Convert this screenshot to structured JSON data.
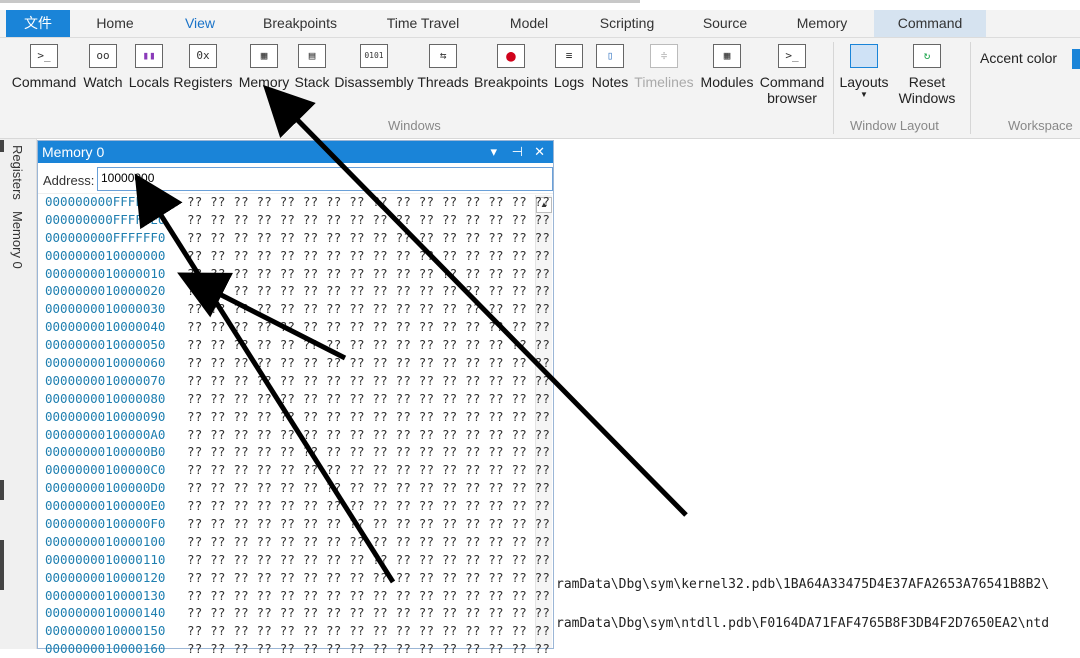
{
  "ribbon_tabs": [
    "文件",
    "Home",
    "View",
    "Breakpoints",
    "Time Travel",
    "Model",
    "Scripting",
    "Source",
    "Memory",
    "Command"
  ],
  "windows_buttons": [
    {
      "label": "Command",
      "icon": "command-prompt-icon",
      "glyph": ">_"
    },
    {
      "label": "Watch",
      "icon": "watch-glasses-icon",
      "glyph": "oo"
    },
    {
      "label": "Locals",
      "icon": "locals-icon",
      "glyph": "▮▮"
    },
    {
      "label": "Registers",
      "icon": "registers-icon",
      "glyph": "0x"
    },
    {
      "label": "Memory",
      "icon": "memory-chip-icon",
      "glyph": "▦"
    },
    {
      "label": "Stack",
      "icon": "stack-icon",
      "glyph": "▤"
    },
    {
      "label": "Disassembly",
      "icon": "disassembly-icon",
      "glyph": "0101"
    },
    {
      "label": "Threads",
      "icon": "threads-icon",
      "glyph": "⇆"
    },
    {
      "label": "Breakpoints",
      "icon": "breakpoint-icon",
      "glyph": "●"
    },
    {
      "label": "Logs",
      "icon": "logs-icon",
      "glyph": "≡"
    },
    {
      "label": "Notes",
      "icon": "notes-icon",
      "glyph": "▯"
    },
    {
      "label": "Timelines",
      "icon": "timelines-icon",
      "glyph": "≑"
    },
    {
      "label": "Modules",
      "icon": "modules-icon",
      "glyph": "▦"
    },
    {
      "label": "Command browser",
      "icon": "command-browser-icon",
      "glyph": ">_"
    }
  ],
  "group_windows": "Windows",
  "layouts_label": "Layouts",
  "reset_label": "Reset Windows",
  "group_window_layout": "Window Layout",
  "accent_label": "Accent color",
  "group_workspace": "Workspace",
  "side_tabs": [
    "Registers",
    "Memory 0"
  ],
  "panel": {
    "title": "Memory 0",
    "address_label": "Address:",
    "address_value": "10000000",
    "rows": [
      "000000000FFFFFD0",
      "000000000FFFFFE0",
      "000000000FFFFFF0",
      "0000000010000000",
      "0000000010000010",
      "0000000010000020",
      "0000000010000030",
      "0000000010000040",
      "0000000010000050",
      "0000000010000060",
      "0000000010000070",
      "0000000010000080",
      "0000000010000090",
      "00000000100000A0",
      "00000000100000B0",
      "00000000100000C0",
      "00000000100000D0",
      "00000000100000E0",
      "00000000100000F0",
      "0000000010000100",
      "0000000010000110",
      "0000000010000120",
      "0000000010000130",
      "0000000010000140",
      "0000000010000150",
      "0000000010000160"
    ],
    "bytes": "?? ?? ?? ?? ?? ?? ?? ?? ?? ?? ?? ?? ?? ?? ?? ??"
  },
  "log_lines": [
    "ramData\\Dbg\\sym\\kernel32.pdb\\1BA64A33475D4E37AFA2653A76541B8B2\\",
    "ramData\\Dbg\\sym\\ntdll.pdb\\F0164DA71FAF4765B8F3DB4F2D7650EA2\\ntd"
  ],
  "colors": {
    "accent": "#1a84d8",
    "address_text": "#1f7fb0"
  }
}
